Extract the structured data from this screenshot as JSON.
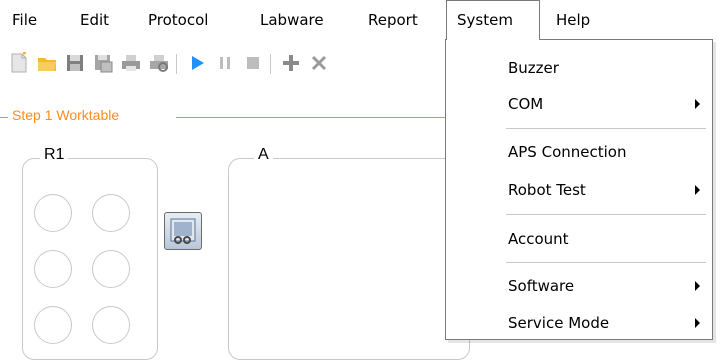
{
  "menubar": {
    "items": [
      {
        "label": "File"
      },
      {
        "label": "Edit"
      },
      {
        "label": "Protocol"
      },
      {
        "label": "Labware"
      },
      {
        "label": "Report"
      },
      {
        "label": "System"
      },
      {
        "label": "Help"
      }
    ],
    "open_menu": "System"
  },
  "toolbar": {
    "icons": [
      "new-icon",
      "open-icon",
      "save-icon",
      "save-as-icon",
      "print-icon",
      "print-preview-icon",
      "run-icon",
      "pause-icon",
      "stop-icon",
      "add-icon",
      "delete-icon"
    ]
  },
  "worktable": {
    "step_title": "Step 1 Worktable",
    "groups": [
      {
        "label": "R1"
      },
      {
        "label": "A"
      }
    ]
  },
  "system_menu": {
    "items": [
      {
        "label": "Buzzer",
        "submenu": false
      },
      {
        "label": "COM",
        "submenu": true
      },
      {
        "label": "APS Connection",
        "submenu": false
      },
      {
        "label": "Robot Test",
        "submenu": true
      },
      {
        "label": "Account",
        "submenu": false
      },
      {
        "label": "Software",
        "submenu": true
      },
      {
        "label": "Service Mode",
        "submenu": true
      }
    ]
  },
  "colors": {
    "accent": "#ff8c1a",
    "run_blue": "#1e90ff",
    "folder_yellow": "#f5b82e"
  }
}
